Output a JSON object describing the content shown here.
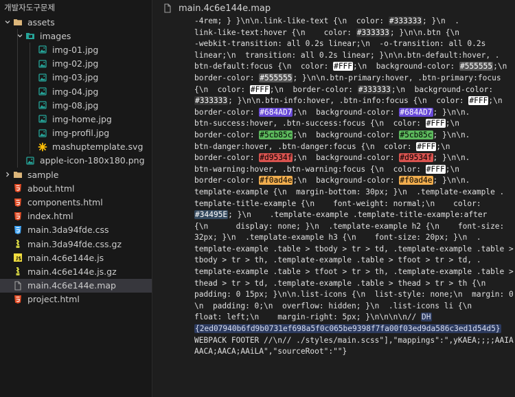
{
  "sidebar": {
    "root_label": "개발자도구문제",
    "colors": {
      "folder": "#dcb67a",
      "image": "#26a69a",
      "svg": "#ffc107",
      "html": "#e44d26",
      "css": "#42a5f5",
      "gz": "#cbcb41",
      "js": "#f1dd3f",
      "map": "#9e9e9e"
    },
    "items": [
      {
        "label": "assets",
        "kind": "folder",
        "open": true,
        "depth": 0,
        "icon": "folder-open-icon"
      },
      {
        "label": "images",
        "kind": "folder-images",
        "open": true,
        "depth": 1,
        "icon": "folder-images-icon"
      },
      {
        "label": "img-01.jpg",
        "kind": "image",
        "depth": 2,
        "icon": "image-file-icon"
      },
      {
        "label": "img-02.jpg",
        "kind": "image",
        "depth": 2,
        "icon": "image-file-icon"
      },
      {
        "label": "img-03.jpg",
        "kind": "image",
        "depth": 2,
        "icon": "image-file-icon"
      },
      {
        "label": "img-04.jpg",
        "kind": "image",
        "depth": 2,
        "icon": "image-file-icon"
      },
      {
        "label": "img-08.jpg",
        "kind": "image",
        "depth": 2,
        "icon": "image-file-icon"
      },
      {
        "label": "img-home.jpg",
        "kind": "image",
        "depth": 2,
        "icon": "image-file-icon"
      },
      {
        "label": "img-profil.jpg",
        "kind": "image",
        "depth": 2,
        "icon": "image-file-icon"
      },
      {
        "label": "mashuptemplate.svg",
        "kind": "svg",
        "depth": 2,
        "icon": "svg-file-icon"
      },
      {
        "label": "apple-icon-180x180.png",
        "kind": "image",
        "depth": 1,
        "icon": "image-file-icon"
      },
      {
        "label": "sample",
        "kind": "folder",
        "open": false,
        "depth": 0,
        "icon": "folder-closed-icon"
      },
      {
        "label": "about.html",
        "kind": "html",
        "depth": 0,
        "icon": "html-file-icon"
      },
      {
        "label": "components.html",
        "kind": "html",
        "depth": 0,
        "icon": "html-file-icon"
      },
      {
        "label": "index.html",
        "kind": "html",
        "depth": 0,
        "icon": "html-file-icon"
      },
      {
        "label": "main.3da94fde.css",
        "kind": "css",
        "depth": 0,
        "icon": "css-file-icon"
      },
      {
        "label": "main.3da94fde.css.gz",
        "kind": "gz",
        "depth": 0,
        "icon": "archive-file-icon"
      },
      {
        "label": "main.4c6e144e.js",
        "kind": "js",
        "depth": 0,
        "icon": "js-file-icon"
      },
      {
        "label": "main.4c6e144e.js.gz",
        "kind": "gz",
        "depth": 0,
        "icon": "archive-file-icon"
      },
      {
        "label": "main.4c6e144e.map",
        "kind": "map",
        "depth": 0,
        "selected": true,
        "icon": "map-file-icon"
      },
      {
        "label": "project.html",
        "kind": "html",
        "depth": 0,
        "icon": "html-file-icon"
      }
    ]
  },
  "editor": {
    "tab": {
      "label": "main.4c6e144e.map",
      "icon": "map-file-icon"
    },
    "lines": [
      [
        {
          "t": "-4rem; } }\\n\\n.link-like-text {\\n  color: "
        },
        {
          "t": "#333333",
          "c": "sw-333"
        },
        {
          "t": "; }\\n  ."
        }
      ],
      [
        {
          "t": "link-like-text:hover {\\n    color: "
        },
        {
          "t": "#333333",
          "c": "sw-333"
        },
        {
          "t": "; }\\n\\n.btn {\\n"
        }
      ],
      [
        {
          "t": "-webkit-transition: all 0.2s linear;\\n  -o-transition: all 0.2s"
        }
      ],
      [
        {
          "t": "linear;\\n  transition: all 0.2s linear; }\\n\\n.btn-default:hover, ."
        }
      ],
      [
        {
          "t": "btn-default:focus {\\n  color: "
        },
        {
          "t": "#FFF",
          "c": "sw-fff"
        },
        {
          "t": ";\\n  background-color: "
        },
        {
          "t": "#555555",
          "c": "sw-555"
        },
        {
          "t": ";\\n"
        }
      ],
      [
        {
          "t": "border-color: "
        },
        {
          "t": "#555555",
          "c": "sw-555"
        },
        {
          "t": "; }\\n\\n.btn-primary:hover, .btn-primary:focus"
        }
      ],
      [
        {
          "t": "{\\n  color: "
        },
        {
          "t": "#FFF",
          "c": "sw-fff"
        },
        {
          "t": ";\\n  border-color: "
        },
        {
          "t": "#333333",
          "c": "sw-333"
        },
        {
          "t": ";\\n  background-color:"
        }
      ],
      [
        {
          "t": ""
        },
        {
          "t": "#333333",
          "c": "sw-333"
        },
        {
          "t": "; }\\n\\n.btn-info:hover, .btn-info:focus {\\n  color: "
        },
        {
          "t": "#FFF",
          "c": "sw-fff"
        },
        {
          "t": ";\\n"
        }
      ],
      [
        {
          "t": "border-color: "
        },
        {
          "t": "#684AD7",
          "c": "sw-684"
        },
        {
          "t": ";\\n  background-color: "
        },
        {
          "t": "#684AD7",
          "c": "sw-684"
        },
        {
          "t": "; }\\n\\n."
        }
      ],
      [
        {
          "t": "btn-success:hover, .btn-success:focus {\\n  color: "
        },
        {
          "t": "#FFF",
          "c": "sw-fff"
        },
        {
          "t": ";\\n"
        }
      ],
      [
        {
          "t": "border-color: "
        },
        {
          "t": "#5cb85c",
          "c": "sw-5cb"
        },
        {
          "t": ";\\n  background-color: "
        },
        {
          "t": "#5cb85c",
          "c": "sw-5cb"
        },
        {
          "t": "; }\\n\\n."
        }
      ],
      [
        {
          "t": "btn-danger:hover, .btn-danger:focus {\\n  color: "
        },
        {
          "t": "#FFF",
          "c": "sw-fff"
        },
        {
          "t": ";\\n"
        }
      ],
      [
        {
          "t": "border-color: "
        },
        {
          "t": "#d9534f",
          "c": "sw-d95"
        },
        {
          "t": ";\\n  background-color: "
        },
        {
          "t": "#d9534f",
          "c": "sw-d95"
        },
        {
          "t": "; }\\n\\n."
        }
      ],
      [
        {
          "t": "btn-warning:hover, .btn-warning:focus {\\n  color: "
        },
        {
          "t": "#FFF",
          "c": "sw-fff"
        },
        {
          "t": ";\\n"
        }
      ],
      [
        {
          "t": "border-color: "
        },
        {
          "t": "#f0ad4e",
          "c": "sw-f0a"
        },
        {
          "t": ";\\n  background-color: "
        },
        {
          "t": "#f0ad4e",
          "c": "sw-f0a"
        },
        {
          "t": "; }\\n\\n."
        }
      ],
      [
        {
          "t": "template-example {\\n  margin-bottom: 30px; }\\n  .template-example ."
        }
      ],
      [
        {
          "t": "template-title-example {\\n    font-weight: normal;\\n    color:"
        }
      ],
      [
        {
          "t": ""
        },
        {
          "t": "#34495E",
          "c": "sw-344"
        },
        {
          "t": "; }\\n    .template-example .template-title-example:after"
        }
      ],
      [
        {
          "t": "{\\n      display: none; }\\n  .template-example h2 {\\n    font-size:"
        }
      ],
      [
        {
          "t": "32px; }\\n  .template-example h3 {\\n    font-size: 20px; }\\n  ."
        }
      ],
      [
        {
          "t": "template-example .table > tbody > tr > td, .template-example .table >"
        }
      ],
      [
        {
          "t": "tbody > tr > th, .template-example .table > tfoot > tr > td, ."
        }
      ],
      [
        {
          "t": "template-example .table > tfoot > tr > th, .template-example .table >"
        }
      ],
      [
        {
          "t": "thead > tr > td, .template-example .table > thead > tr > th {\\n"
        }
      ],
      [
        {
          "t": "padding: 0 15px; }\\n\\n.list-icons {\\n  list-style: none;\\n  margin: 0;"
        }
      ],
      [
        {
          "t": "\\n  padding: 0;\\n  overflow: hidden; }\\n  .list-icons li {\\n"
        }
      ],
      [
        {
          "t": "float: left;\\n    margin-right: 5px; }\\n\\n\\n\\n// "
        },
        {
          "t": "DH",
          "c": "hl"
        }
      ],
      [
        {
          "t": "{2ed07940b6fd9b0731ef698a5f0c065be9398f7fa00f03ed9da586c3ed1d54d5}",
          "c": "hl"
        }
      ],
      [
        {
          "t": "WEBPACK FOOTER //\\n// ./styles/main.scss\"],\"mappings\":\",yKAEA;;;;AAIA;"
        }
      ],
      [
        {
          "t": "AACA;AACA;AAiLA\",\"sourceRoot\":\"\"}"
        }
      ]
    ]
  }
}
